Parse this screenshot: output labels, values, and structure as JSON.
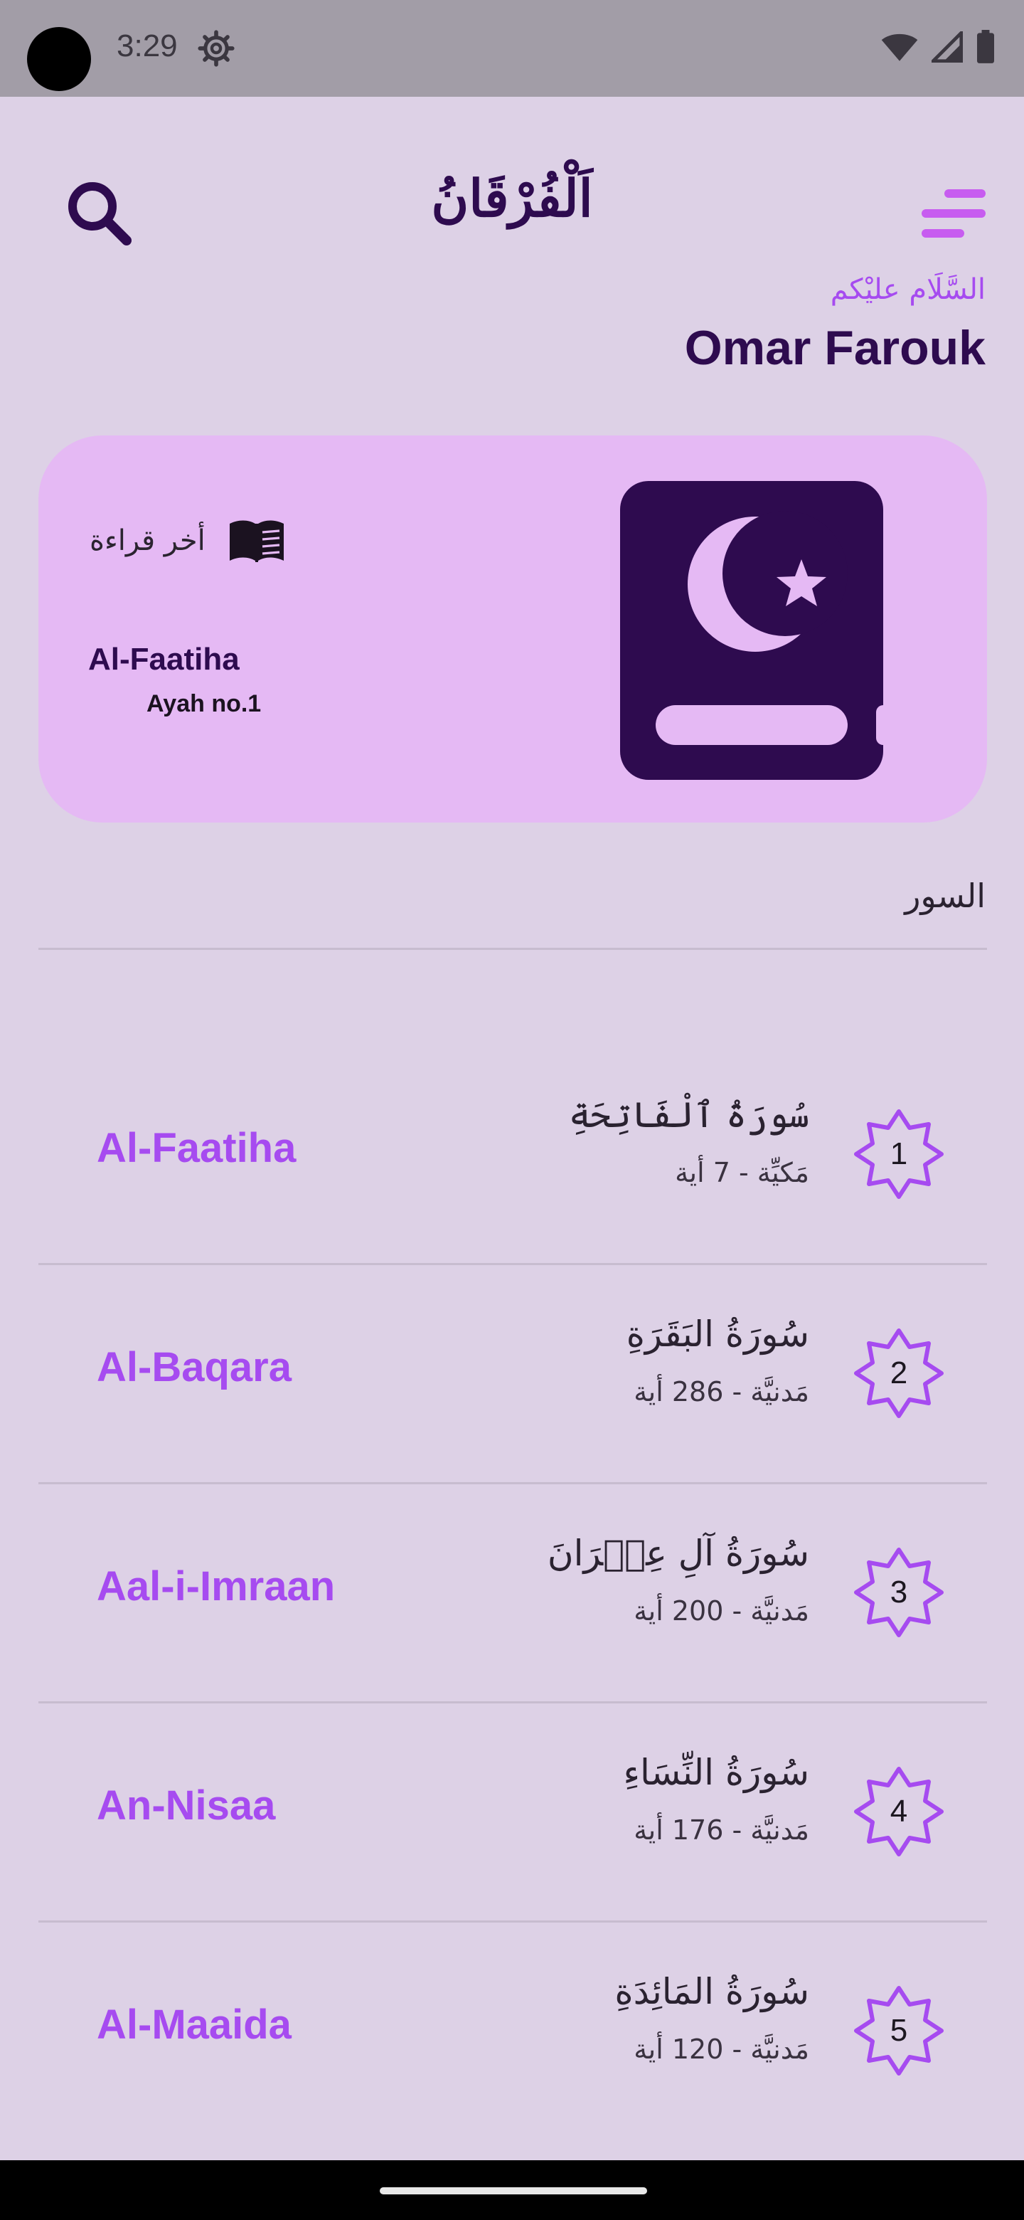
{
  "status_bar": {
    "time": "3:29"
  },
  "header": {
    "title": "اَلْفُرْقَانُ"
  },
  "greeting": {
    "salutation": "السَّلَام عليْكم",
    "name": "Omar Farouk"
  },
  "last_read": {
    "label": "أخر قراءة",
    "surah": "Al-Faatiha",
    "ayah": "Ayah no.1"
  },
  "section": {
    "title": "السور"
  },
  "surahs": [
    {
      "number": "1",
      "english": "Al-Faatiha",
      "arabic": "سُورَةُ ٱلْفَاتِحَةِ",
      "meta": "مَكيِّة - 7 أية"
    },
    {
      "number": "2",
      "english": "Al-Baqara",
      "arabic": "سُورَةُ البَقَرَةِ",
      "meta": "مَدنيَّة - 286 أية"
    },
    {
      "number": "3",
      "english": "Aal-i-Imraan",
      "arabic": "سُورَةُ آلِ عِمۡرَانَ",
      "meta": "مَدنيَّة - 200 أية"
    },
    {
      "number": "4",
      "english": "An-Nisaa",
      "arabic": "سُورَةُ النِّسَاءِ",
      "meta": "مَدنيَّة - 176 أية"
    },
    {
      "number": "5",
      "english": "Al-Maaida",
      "arabic": "سُورَةُ المَائِدَةِ",
      "meta": "مَدنيَّة - 120 أية"
    }
  ],
  "colors": {
    "accent": "#A64BF0",
    "dark_purple": "#2E0B4F",
    "card_bg": "#E5B9F4",
    "page_bg": "#DDD1E6"
  },
  "icons": [
    "search-icon",
    "menu-icon",
    "book-open-icon",
    "quran-book-icon",
    "star-badge-icon",
    "settings-gear-icon",
    "wifi-icon",
    "signal-icon",
    "battery-icon"
  ]
}
